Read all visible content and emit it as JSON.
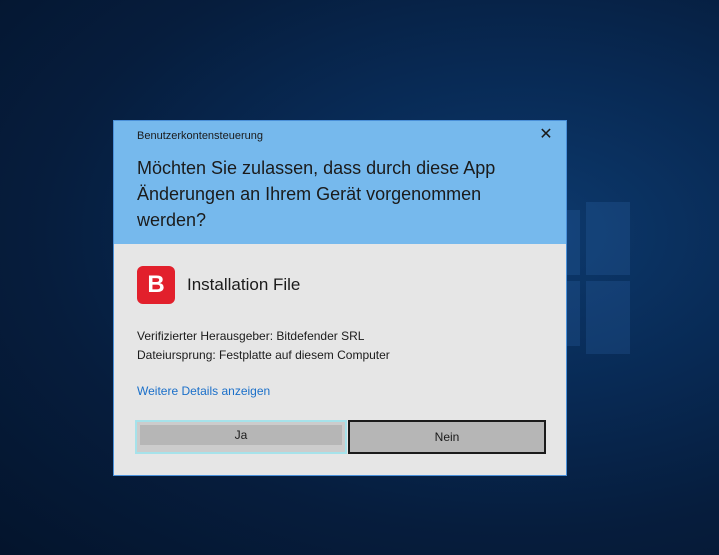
{
  "dialog": {
    "window_title": "Benutzerkontensteuerung",
    "close_glyph": "✕",
    "question": "Möchten Sie zulassen, dass durch diese App Änderungen an Ihrem Gerät vorgenommen werden?",
    "app": {
      "icon_letter": "B",
      "icon_name": "bitdefender-icon",
      "icon_color": "#e2202c",
      "name": "Installation File"
    },
    "publisher": "Verifizierter Herausgeber: Bitdefender SRL",
    "origin": "Dateiursprung: Festplatte auf diesem Computer",
    "details_link": "Weitere Details anzeigen",
    "buttons": {
      "yes": "Ja",
      "no": "Nein"
    }
  },
  "colors": {
    "header": "#76b9ed",
    "body": "#e6e6e6",
    "link": "#1a6fc9",
    "focus_ring": "#a6e2ea"
  }
}
